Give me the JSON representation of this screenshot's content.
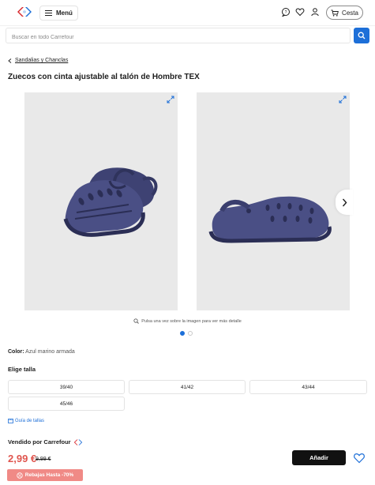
{
  "header": {
    "menu_label": "Menú",
    "cart_label": "Cesta",
    "brand_color": "#1d6fd8",
    "icons": [
      "carrefour-logo",
      "hamburger-icon",
      "chat-icon",
      "heart-icon",
      "user-icon",
      "cart-icon"
    ]
  },
  "search": {
    "placeholder": "Buscar en todo Carrefour",
    "value": ""
  },
  "breadcrumb": {
    "label": "Sandalias y Chanclas"
  },
  "product": {
    "title": "Zuecos con cinta ajustable al talón de Hombre TEX",
    "image_hint": "Pulsa una vez sobre la imagen para ver más detalle",
    "carousel_index": 1,
    "carousel_total": 2,
    "color_label": "Color:",
    "color_value": "Azul marino armada",
    "size_label": "Elige talla",
    "sizes": [
      "39/40",
      "41/42",
      "43/44",
      "45/46"
    ],
    "size_guide": "Guía de tallas",
    "sold_by": "Vendido por Carrefour",
    "price": "2,99 €",
    "old_price": "9,99 €",
    "add_label": "Añadir",
    "promo": "Rebajas Hasta -70%",
    "price_color": "#e0564f",
    "promo_color": "#f08a86"
  }
}
